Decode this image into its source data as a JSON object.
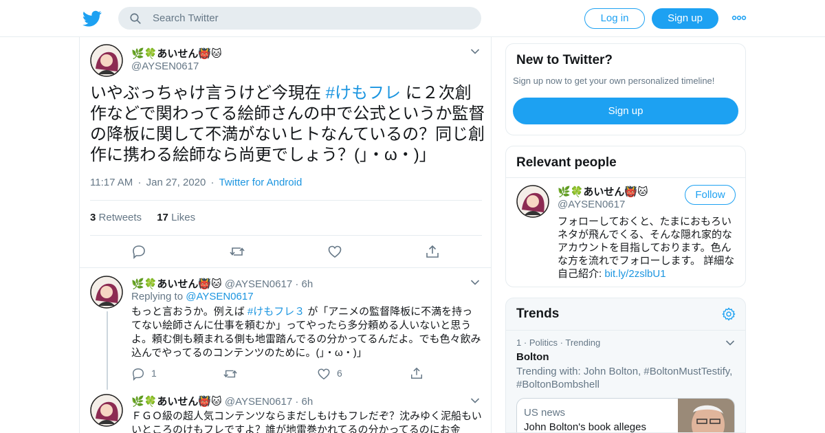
{
  "header": {
    "search_placeholder": "Search Twitter",
    "login_label": "Log in",
    "signup_label": "Sign up"
  },
  "tweet": {
    "name": "🌿🍀あいせん👹🐱",
    "handle": "@AYSEN0617",
    "text_before": "いやぶっちゃけ言うけど今現在 ",
    "hashtag": "#けもフレ",
    "text_after": " に２次創作などで関わってる絵師さんの中で公式というか監督の降板に関して不満がないヒトなんているの？同じ創作に携わる絵師なら尚更でしょう？(」・ω・)」",
    "time": "11:17 AM",
    "date": "Jan 27, 2020",
    "source": "Twitter for Android",
    "retweets_count": "3",
    "retweets_label": "Retweets",
    "likes_count": "17",
    "likes_label": "Likes"
  },
  "replies": [
    {
      "name": "🌿🍀あいせん👹🐱",
      "handle": "@AYSEN0617",
      "age": "6h",
      "replying_label": "Replying to",
      "replying_handle": "@AYSEN0617",
      "text_before": "もっと言おうか。例えば ",
      "hashtag": "#けもフレ３",
      "text_after": " が「アニメの監督降板に不満を持ってない絵師さんに仕事を頼むか」ってやったら多分頼める人いないと思うよ。頼む側も頼まれる側も地雷踏んでるの分かってるんだよ。でも色々飲み込んでやってるのコンテンツのために。(」・ω・)」",
      "reply_count": "1",
      "like_count": "6"
    },
    {
      "name": "🌿🍀あいせん👹🐱",
      "handle": "@AYSEN0617",
      "age": "6h",
      "text": "ＦＧＯ級の超人気コンテンツならまだしもけもフレだぞ？沈みゆく泥船もいいところのけもフレですよ？誰が地雷巻かれてるの分かってるのにお金"
    }
  ],
  "new_to_twitter": {
    "title": "New to Twitter?",
    "subtitle": "Sign up now to get your own personalized timeline!",
    "signup_label": "Sign up"
  },
  "relevant_people": {
    "title": "Relevant people",
    "name": "🌿🍀あいせん👹🐱",
    "handle": "@AYSEN0617",
    "follow_label": "Follow",
    "bio": "フォローしておくと、たまにおもろいネタが飛んでくる、そんな隠れ家的なアカウントを目指しております。色んな方を流れでフォローします。 詳細な自己紹介: ",
    "bio_link": "bit.ly/2zslbU1"
  },
  "trends": {
    "title": "Trends",
    "item": {
      "rank": "1",
      "category": "Politics",
      "status": "Trending",
      "name": "Bolton",
      "trending_with": "Trending with: John Bolton, #BoltonMustTestify, #BoltonBombshell"
    },
    "news": {
      "source": "US news",
      "headline": "John Bolton's book alleges"
    }
  },
  "colors": {
    "brand_blue": "#1da1f2",
    "link_blue": "#1b95e0",
    "muted": "#657786"
  }
}
